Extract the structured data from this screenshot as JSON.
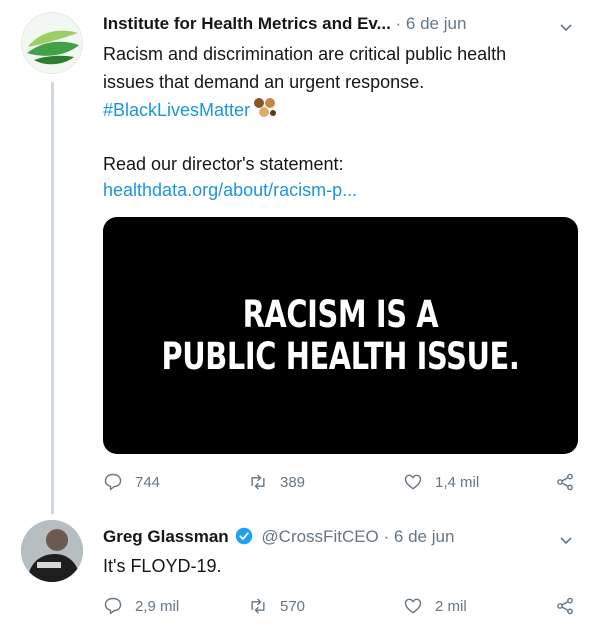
{
  "tweet1": {
    "author": "Institute for Health Metrics and Ev...",
    "date": "6 de jun",
    "line1": "Racism and discrimination are critical public health",
    "line2": "issues that demand an urgent response.",
    "hashtag": "#BlackLivesMatter",
    "statement": "Read our director's statement:",
    "link": "healthdata.org/about/racism-p...",
    "image_line1": "RACISM IS A",
    "image_line2": "PUBLIC HEALTH ISSUE.",
    "replies": "744",
    "retweets": "389",
    "likes": "1,4 mil"
  },
  "tweet2": {
    "author": "Greg Glassman",
    "handle": "@CrossFitCEO",
    "date": "6 de jun",
    "text": "It's FLOYD-19.",
    "replies": "2,9 mil",
    "retweets": "570",
    "likes": "2 mil"
  },
  "colors": {
    "link": "#1b95e0",
    "muted": "#657786",
    "verified": "#1da1f2",
    "brand_green": "#4caf50"
  },
  "icons": [
    "chevron-down-icon",
    "reply-icon",
    "retweet-icon",
    "like-icon",
    "share-icon",
    "verified-badge-icon",
    "fist-emoji-icon"
  ]
}
